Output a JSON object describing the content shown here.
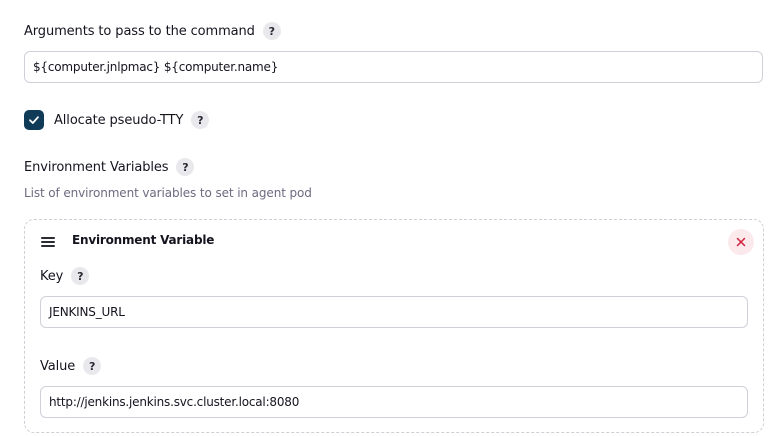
{
  "arguments": {
    "label": "Arguments to pass to the command",
    "help": "?",
    "value": "${computer.jnlpmac} ${computer.name}"
  },
  "tty": {
    "label": "Allocate pseudo-TTY",
    "help": "?",
    "checked": true
  },
  "env": {
    "label": "Environment Variables",
    "help": "?",
    "description": "List of environment variables to set in agent pod",
    "item": {
      "title": "Environment Variable",
      "key_label": "Key",
      "key_help": "?",
      "key_value": "JENKINS_URL",
      "value_label": "Value",
      "value_help": "?",
      "value_value": "http://jenkins.jenkins.svc.cluster.local:8080"
    }
  },
  "colors": {
    "checkbox": "#0f3b58",
    "delete_icon": "#d3203a",
    "delete_bg": "#fbe9ec"
  },
  "icons": {
    "drag": "drag-handle-icon",
    "delete": "close-icon",
    "check": "checkmark-icon"
  }
}
